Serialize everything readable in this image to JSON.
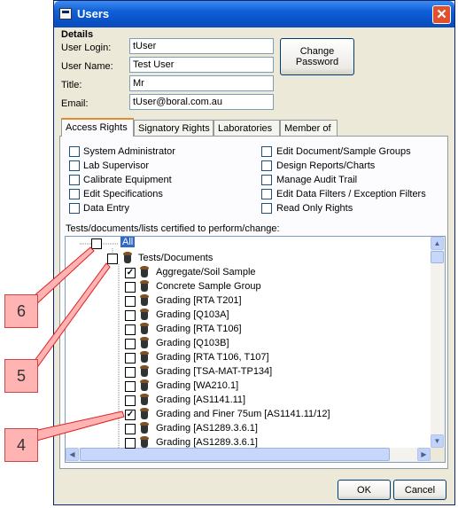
{
  "window": {
    "title": "Users",
    "close_glyph": "✕"
  },
  "details": {
    "heading": "Details",
    "user_login_label": "User Login:",
    "user_login_value": "tUser",
    "user_name_label": "User Name:",
    "user_name_value": "Test User",
    "title_label": "Title:",
    "title_value": "Mr",
    "email_label": "Email:",
    "email_value": "tUser@boral.com.au",
    "change_password_line1": "Change",
    "change_password_line2": "Password"
  },
  "tabs": [
    "Access Rights",
    "Signatory Rights",
    "Laboratories",
    "Member of"
  ],
  "rights_left": [
    "System Administrator",
    "Lab Supervisor",
    "Calibrate Equipment",
    "Edit Specifications",
    "Data Entry"
  ],
  "rights_right": [
    "Edit Document/Sample Groups",
    "Design Reports/Charts",
    "Manage Audit Trail",
    "Edit Data Filters / Exception Filters",
    "Read Only Rights"
  ],
  "tree": {
    "heading": "Tests/documents/lists certified to perform/change:",
    "root_label": "All",
    "group_label": "Tests/Documents",
    "items": [
      {
        "label": "Aggregate/Soil Sample",
        "checked": true
      },
      {
        "label": "Concrete Sample Group",
        "checked": false
      },
      {
        "label": "Grading [RTA T201]",
        "checked": false
      },
      {
        "label": "Grading [Q103A]",
        "checked": false
      },
      {
        "label": "Grading [RTA T106]",
        "checked": false
      },
      {
        "label": "Grading [Q103B]",
        "checked": false
      },
      {
        "label": "Grading [RTA T106, T107]",
        "checked": false
      },
      {
        "label": "Grading [TSA-MAT-TP134]",
        "checked": false
      },
      {
        "label": "Grading [WA210.1]",
        "checked": false
      },
      {
        "label": "Grading [AS1141.11]",
        "checked": false
      },
      {
        "label": "Grading and Finer 75um [AS1141.11/12]",
        "checked": true
      },
      {
        "label": "Grading [AS1289.3.6.1]",
        "checked": false
      },
      {
        "label": "Grading [AS1289.3.6.1]",
        "checked": false
      }
    ]
  },
  "buttons": {
    "ok": "OK",
    "cancel": "Cancel"
  },
  "callouts": [
    "6",
    "5",
    "4"
  ],
  "colors": {
    "callout_fill": "#ffb3b3",
    "callout_line": "#e02020",
    "title_bar": "#0a4fc2",
    "tab_highlight": "#e68b2c"
  }
}
